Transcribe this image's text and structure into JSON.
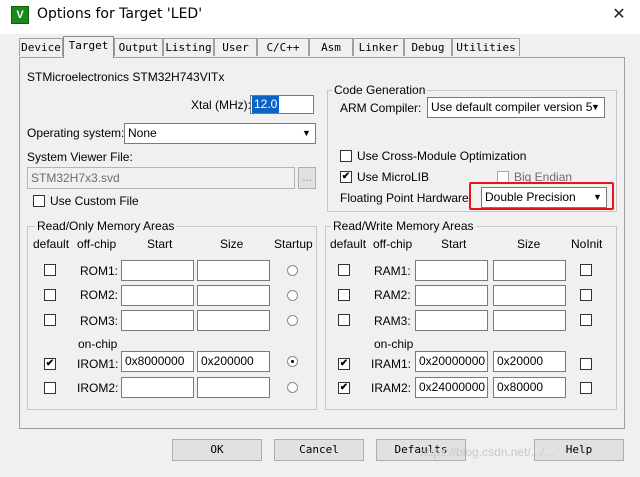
{
  "window": {
    "title": "Options for Target 'LED'",
    "icon_glyph": "V",
    "close_glyph": "✕"
  },
  "tabs": [
    "Device",
    "Target",
    "Output",
    "Listing",
    "User",
    "C/C++",
    "Asm",
    "Linker",
    "Debug",
    "Utilities"
  ],
  "active_tab": "Target",
  "device": {
    "name": "STMicroelectronics STM32H743VITx"
  },
  "xtal": {
    "label": "Xtal (MHz):",
    "value": "12.0"
  },
  "os": {
    "label": "Operating system:",
    "value": "None"
  },
  "svf": {
    "label": "System Viewer File:",
    "value": "STM32H7x3.svd",
    "browse": "...",
    "custom_label": "Use Custom File",
    "custom_checked": false
  },
  "codegen": {
    "title": "Code Generation",
    "compiler_label": "ARM Compiler:",
    "compiler_value": "Use default compiler version 5",
    "cross_module_label": "Use Cross-Module Optimization",
    "cross_module_checked": false,
    "microlib_label": "Use MicroLIB",
    "microlib_checked": true,
    "big_endian_label": "Big Endian",
    "big_endian_checked": false,
    "fpu_label": "Floating Point Hardware:",
    "fpu_value": "Double Precision"
  },
  "ro_mem": {
    "title": "Read/Only Memory Areas",
    "headers": {
      "default": "default",
      "offchip": "off-chip",
      "start": "Start",
      "size": "Size",
      "startup": "Startup"
    },
    "onchip_label": "on-chip",
    "rows": [
      {
        "name": "ROM1:",
        "checked": false,
        "start": "",
        "size": "",
        "startup": false
      },
      {
        "name": "ROM2:",
        "checked": false,
        "start": "",
        "size": "",
        "startup": false
      },
      {
        "name": "ROM3:",
        "checked": false,
        "start": "",
        "size": "",
        "startup": false
      },
      {
        "name": "IROM1:",
        "checked": true,
        "start": "0x8000000",
        "size": "0x200000",
        "startup": true
      },
      {
        "name": "IROM2:",
        "checked": false,
        "start": "",
        "size": "",
        "startup": false
      }
    ]
  },
  "rw_mem": {
    "title": "Read/Write Memory Areas",
    "headers": {
      "default": "default",
      "offchip": "off-chip",
      "start": "Start",
      "size": "Size",
      "noinit": "NoInit"
    },
    "onchip_label": "on-chip",
    "rows": [
      {
        "name": "RAM1:",
        "checked": false,
        "start": "",
        "size": "",
        "noinit": false
      },
      {
        "name": "RAM2:",
        "checked": false,
        "start": "",
        "size": "",
        "noinit": false
      },
      {
        "name": "RAM3:",
        "checked": false,
        "start": "",
        "size": "",
        "noinit": false
      },
      {
        "name": "IRAM1:",
        "checked": true,
        "start": "0x20000000",
        "size": "0x20000",
        "noinit": false
      },
      {
        "name": "IRAM2:",
        "checked": true,
        "start": "0x24000000",
        "size": "0x80000",
        "noinit": false
      }
    ]
  },
  "buttons": {
    "ok": "OK",
    "cancel": "Cancel",
    "defaults": "Defaults",
    "help": "Help"
  },
  "watermark": "https://blog.csdn.net/.../...",
  "colors": {
    "selection": "#0a64c8",
    "highlight": "#e8141a",
    "icon_green": "#1a8a1a"
  }
}
